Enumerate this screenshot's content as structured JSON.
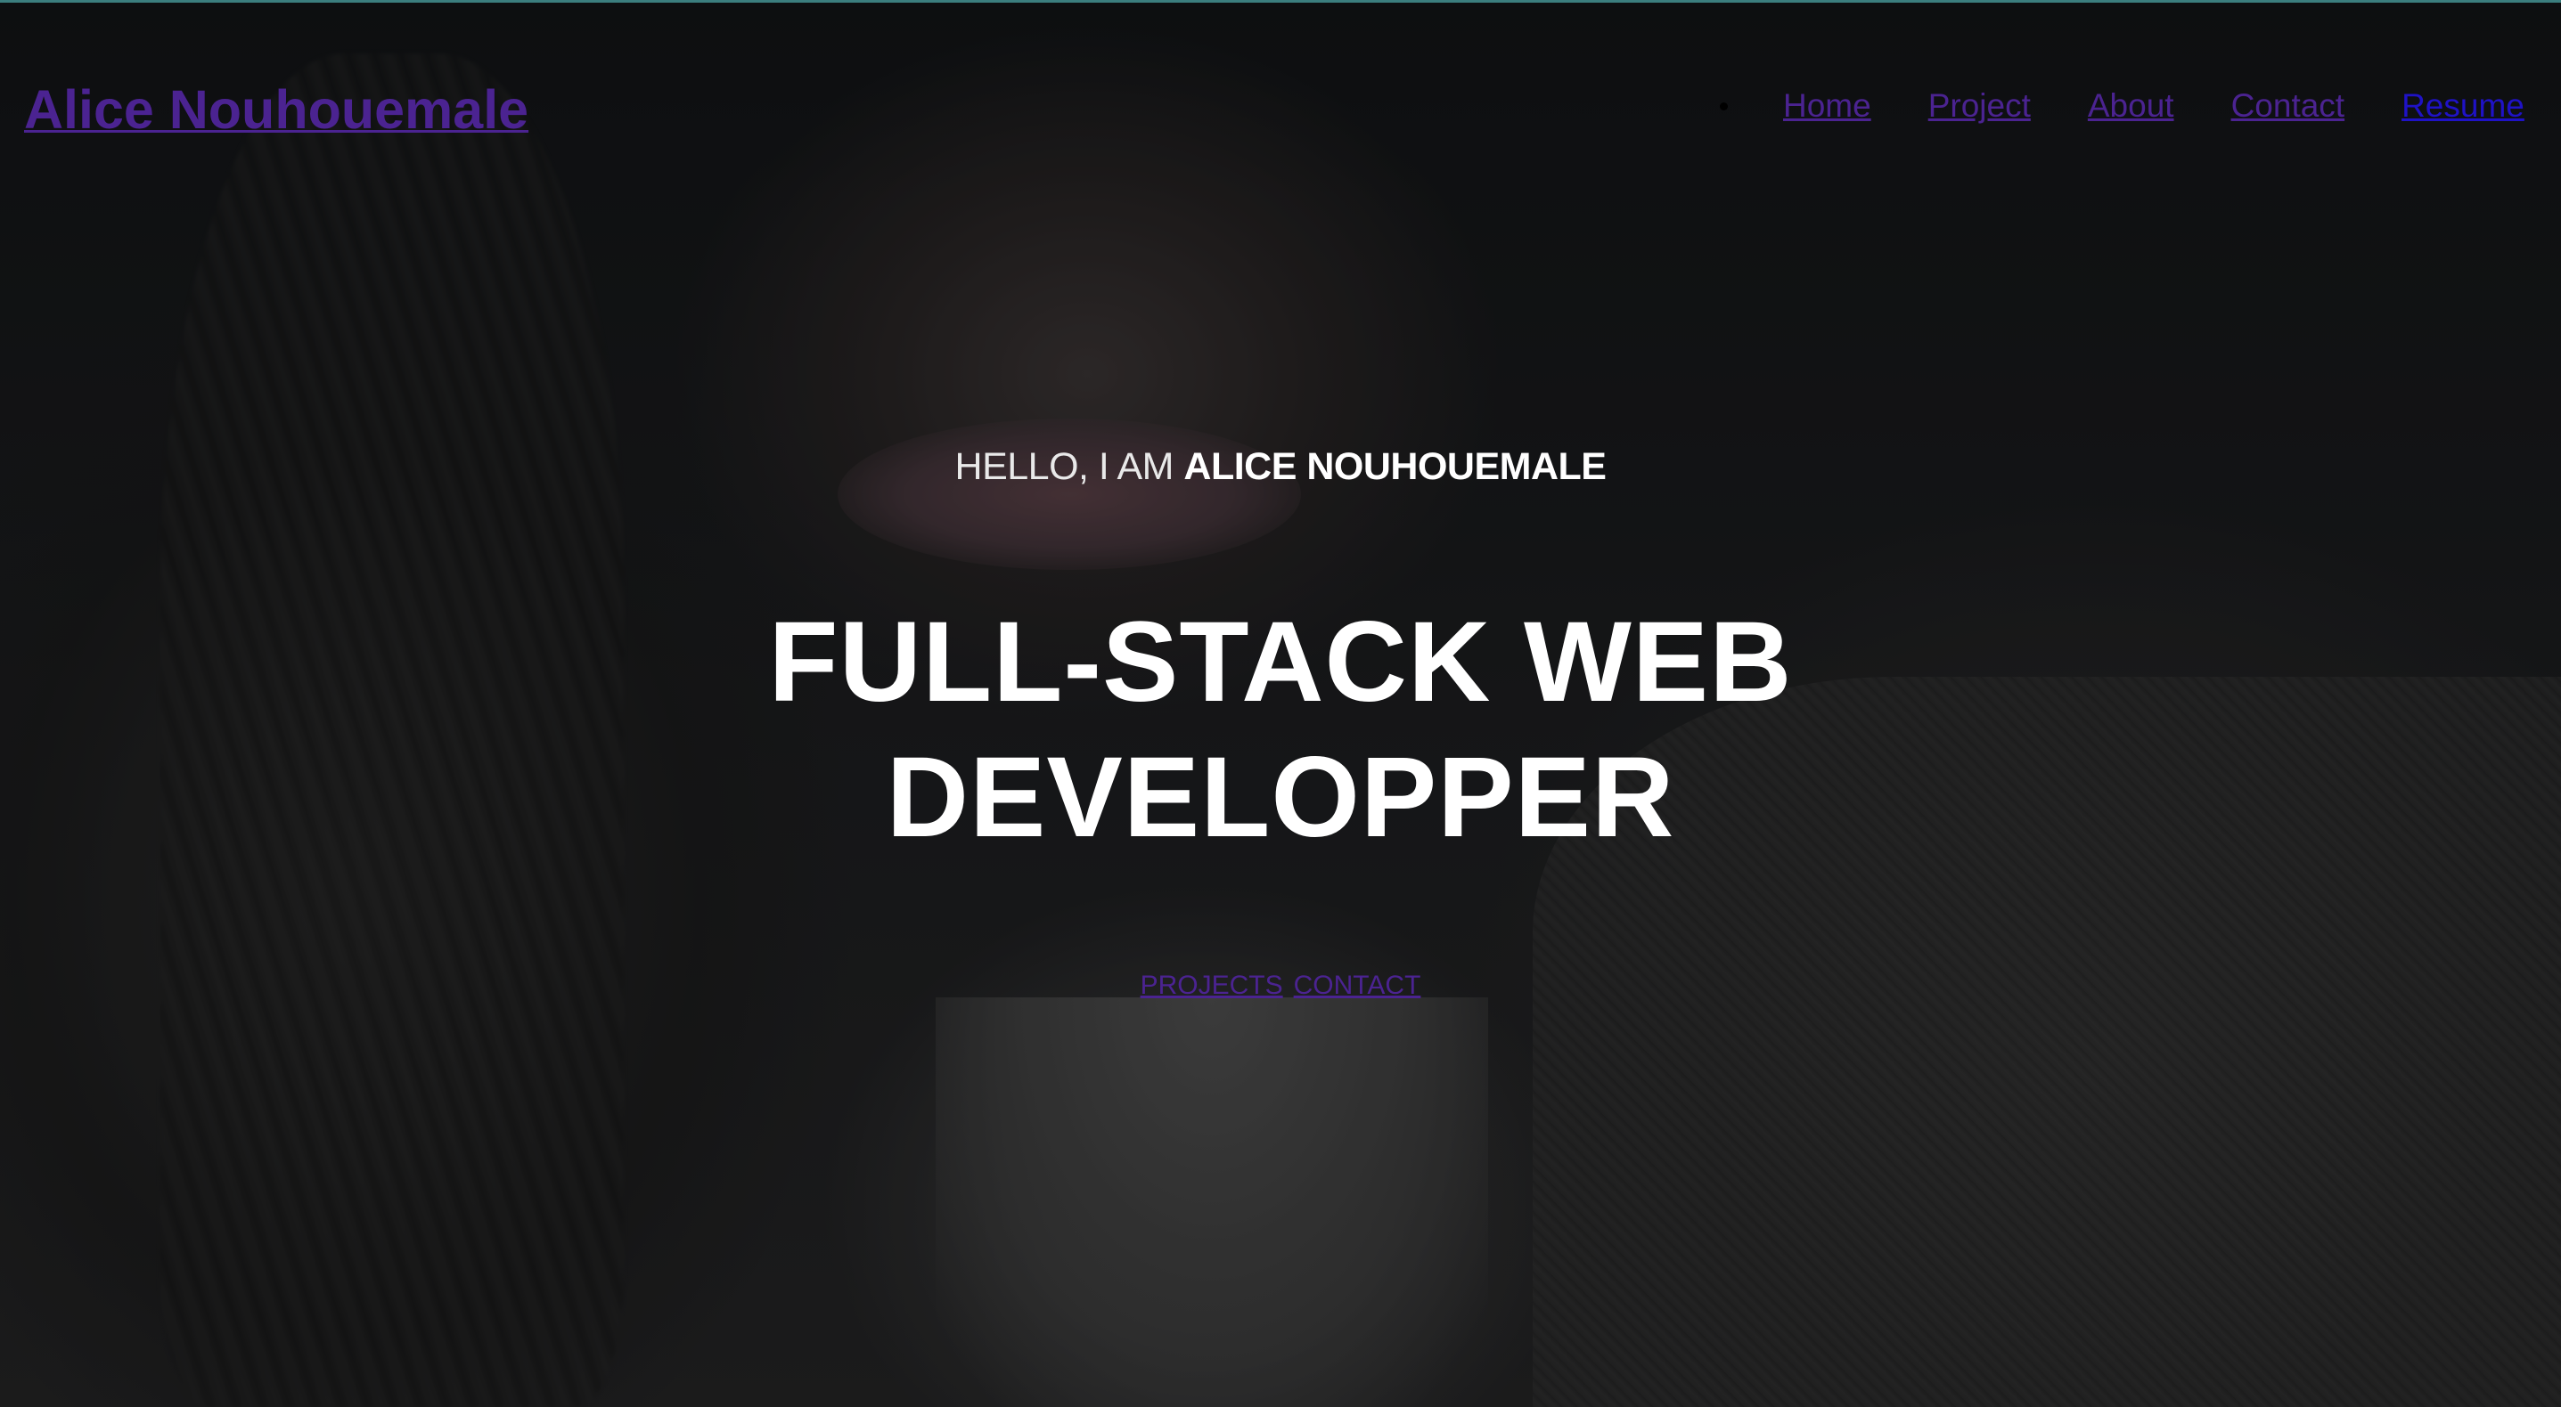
{
  "header": {
    "brand": "Alice Nouhouemale",
    "nav": [
      {
        "label": "Home"
      },
      {
        "label": "Project"
      },
      {
        "label": "About"
      },
      {
        "label": "Contact"
      },
      {
        "label": "Resume"
      }
    ]
  },
  "hero": {
    "intro_prefix": "HELLO, I AM ",
    "intro_name": "ALICE NOUHOUEMALE",
    "title_line1": "FULL-STACK WEB",
    "title_line2": "DEVELOPPER",
    "buttons": [
      {
        "label": "PROJECTS"
      },
      {
        "label": "CONTACT"
      }
    ]
  },
  "colors": {
    "link": "#4b2391",
    "link_visited_blue": "#1f12c6",
    "accent_top_line": "#4fa8a8",
    "text": "#ffffff"
  }
}
